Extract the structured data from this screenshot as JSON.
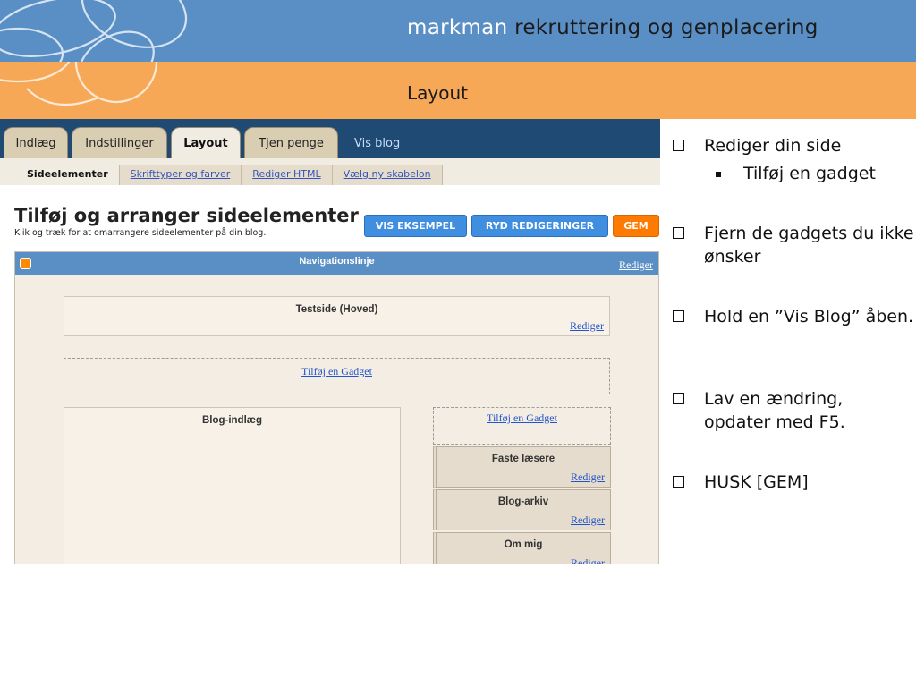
{
  "header": {
    "brand_part1": "markman",
    "brand_part2": "rekruttering og genplacering",
    "slide_title": "Layout"
  },
  "blogger": {
    "tabs": [
      {
        "label": "Indlæg"
      },
      {
        "label": "Indstillinger"
      },
      {
        "label": "Layout"
      },
      {
        "label": "Tjen penge"
      }
    ],
    "view_blog_link": "Vis blog",
    "subtabs": [
      {
        "label": "Sideelementer"
      },
      {
        "label": "Skrifttyper og farver"
      },
      {
        "label": "Rediger HTML"
      },
      {
        "label": "Vælg ny skabelon"
      }
    ],
    "page_heading": "Tilføj og arranger sideelementer",
    "page_subtext": "Klik og træk for at omarrangere sideelementer på din blog.",
    "buttons": {
      "preview": "VIS EKSEMPEL",
      "clear": "RYD REDIGERINGER",
      "save": "GEM"
    },
    "navbar": {
      "title": "Navigationslinje",
      "edit": "Rediger"
    },
    "header_box": {
      "title": "Testside (Hoved)",
      "edit": "Rediger"
    },
    "add_gadget_main": "Tilføj en Gadget",
    "posts_box": {
      "title": "Blog-indlæg"
    },
    "add_gadget_sidebar": "Tilføj en Gadget",
    "sidebar_gadgets": [
      {
        "title": "Faste læsere",
        "edit": "Rediger"
      },
      {
        "title": "Blog-arkiv",
        "edit": "Rediger"
      },
      {
        "title": "Om mig",
        "edit": "Rediger"
      }
    ]
  },
  "bullets": {
    "item1": "Rediger din side",
    "item1_sub": "Tilføj en gadget",
    "item2": "Fjern de gadgets du ikke ønsker",
    "item3": "Hold en ”Vis Blog” åben.",
    "item4": "Lav en ændring, opdater med F5.",
    "item5": "HUSK [GEM]"
  },
  "colors": {
    "header_blue": "#5a8fc6",
    "header_orange": "#f6a857",
    "tabbar_navy": "#1f4a73",
    "save_orange": "#ff7a00",
    "action_blue": "#3f8ee0"
  }
}
